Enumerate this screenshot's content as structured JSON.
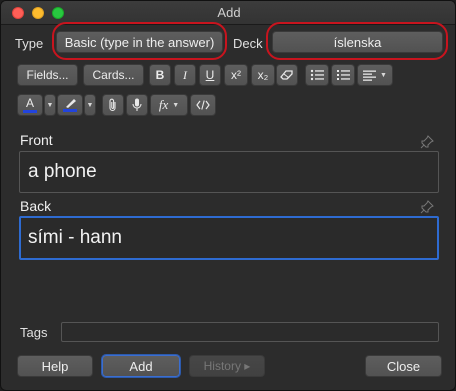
{
  "window": {
    "title": "Add"
  },
  "top_row": {
    "type_label": "Type",
    "note_type": "Basic (type in the answer)",
    "deck_label": "Deck",
    "deck": "íslenska"
  },
  "toolbar": {
    "fields_label": "Fields...",
    "cards_label": "Cards...",
    "bold_label": "B",
    "italic_label": "I",
    "underline_label": "U",
    "superscript_label": "x²",
    "subscript_label": "x₂",
    "text_color_label": "A",
    "function_label": "fx"
  },
  "fields": [
    {
      "name": "Front",
      "value": "a phone"
    },
    {
      "name": "Back",
      "value": "sími - hann"
    }
  ],
  "tags": {
    "label": "Tags",
    "value": ""
  },
  "buttons": {
    "help": "Help",
    "add": "Add",
    "history": "History ▸",
    "close": "Close"
  },
  "colors": {
    "highlight_ring": "#c8141e",
    "focus_border": "#2e6bd1",
    "text_color_bar": "#2244dd"
  }
}
